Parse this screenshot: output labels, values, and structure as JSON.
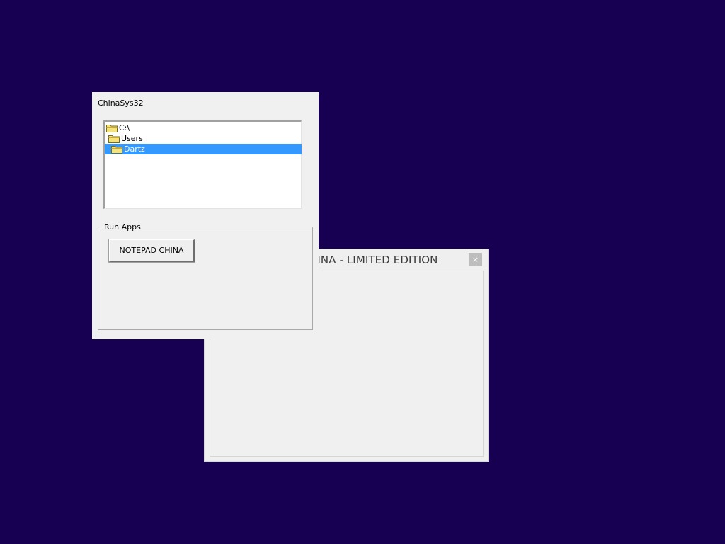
{
  "notepad_window": {
    "title": "HINA - LIMITED EDITION",
    "close_label": "×"
  },
  "sys_window": {
    "title": "ChinaSys32",
    "tree": [
      {
        "label": "C:\\",
        "selected": false
      },
      {
        "label": "Users",
        "selected": false
      },
      {
        "label": "Dartz",
        "selected": true
      }
    ],
    "run_apps": {
      "group_label": "Run Apps",
      "notepad_button": "NOTEPAD CHINA"
    }
  },
  "colors": {
    "desktop": "#170051",
    "window_bg": "#f0f0f0",
    "selection": "#3399ff"
  },
  "icons": {
    "folder": "folder-icon",
    "close": "close-icon"
  }
}
